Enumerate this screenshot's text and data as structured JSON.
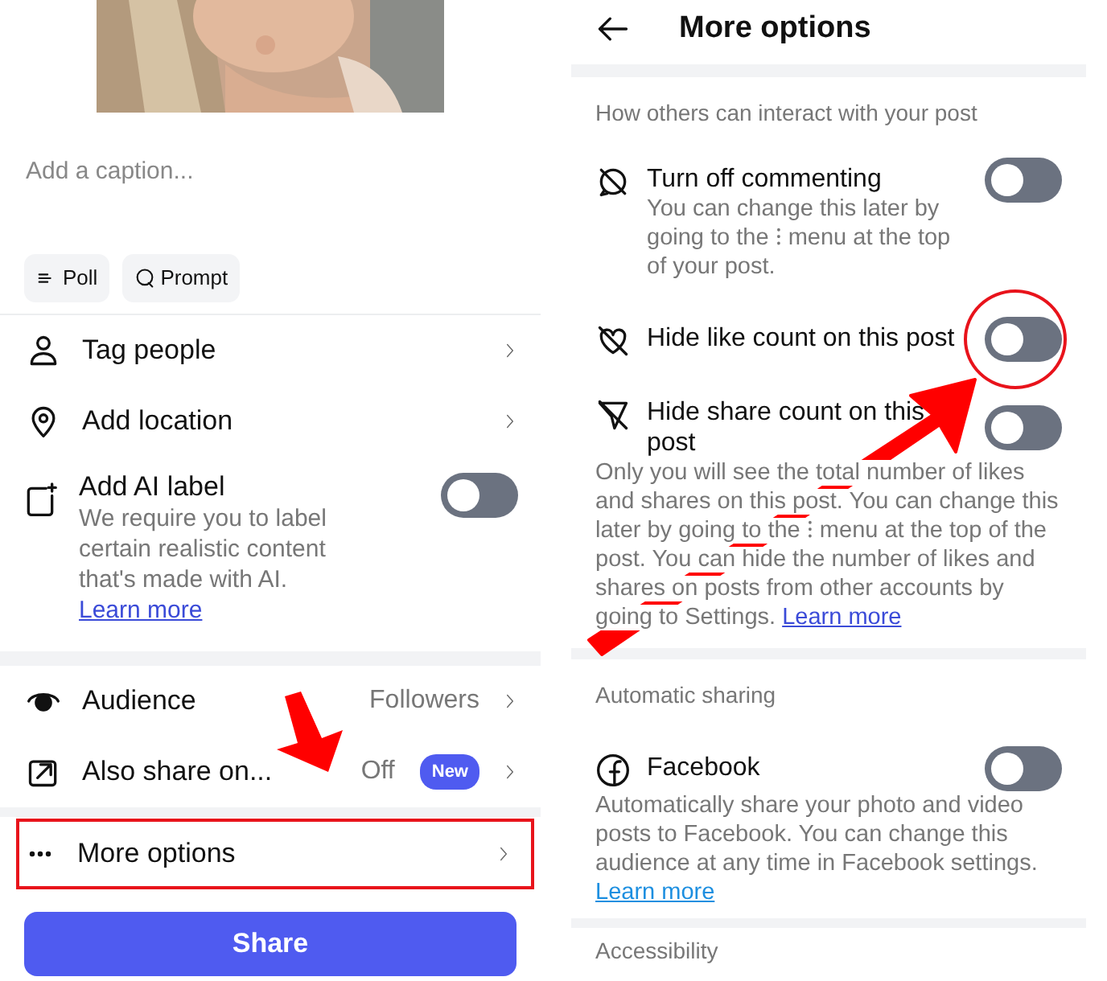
{
  "compose": {
    "photo": {
      "kind": "picture"
    },
    "caption": {
      "placeholder": "Add a caption..."
    },
    "chips": [
      {
        "label": "Poll"
      },
      {
        "label": "Prompt"
      }
    ],
    "groups": [
      [
        {
          "kind": "link",
          "label": "Tag people",
          "highlighted": false
        },
        {
          "kind": "link",
          "label": "Add location",
          "highlighted": false
        },
        {
          "kind": "toggle",
          "label": "Add AI label",
          "on": false,
          "highlighted": false,
          "description": "We require you to label certain realistic content that's made with AI.",
          "link": "Learn more"
        }
      ],
      [
        {
          "kind": "link",
          "label": "Audience",
          "value": "Followers",
          "highlighted": false
        },
        {
          "kind": "link",
          "label": "Also share on...",
          "value": "Off",
          "badge": "New",
          "highlighted": false
        }
      ],
      [
        {
          "kind": "link",
          "label": "More options",
          "highlighted": true
        }
      ]
    ],
    "share_button": "Share"
  },
  "more_options": {
    "title": "More options",
    "sections": [
      {
        "title": "How others can interact with your post",
        "items": [
          {
            "label": "Turn off commenting",
            "description": "You can change this later by going to the ⁝ menu at the top of your post.",
            "on": false,
            "circled": false
          },
          {
            "label": "Hide like count on this post",
            "on": false,
            "circled": true
          },
          {
            "label": "Hide share count on this post",
            "on": false,
            "circled": false
          }
        ],
        "note": "Only you will see the total number of likes and shares on this post. You can change this later by going to the ⁝ menu at the top of the post. You can hide the number of likes and shares on posts from other accounts by going to Settings.",
        "link": "Learn more"
      },
      {
        "title": "Automatic sharing",
        "items": [
          {
            "label": "Facebook",
            "on": false,
            "circled": false
          }
        ],
        "note": "Automatically share your photo and video posts to Facebook. You can change this audience at any time in Facebook settings.",
        "link": "Learn more"
      },
      {
        "title": "Accessibility"
      }
    ]
  }
}
